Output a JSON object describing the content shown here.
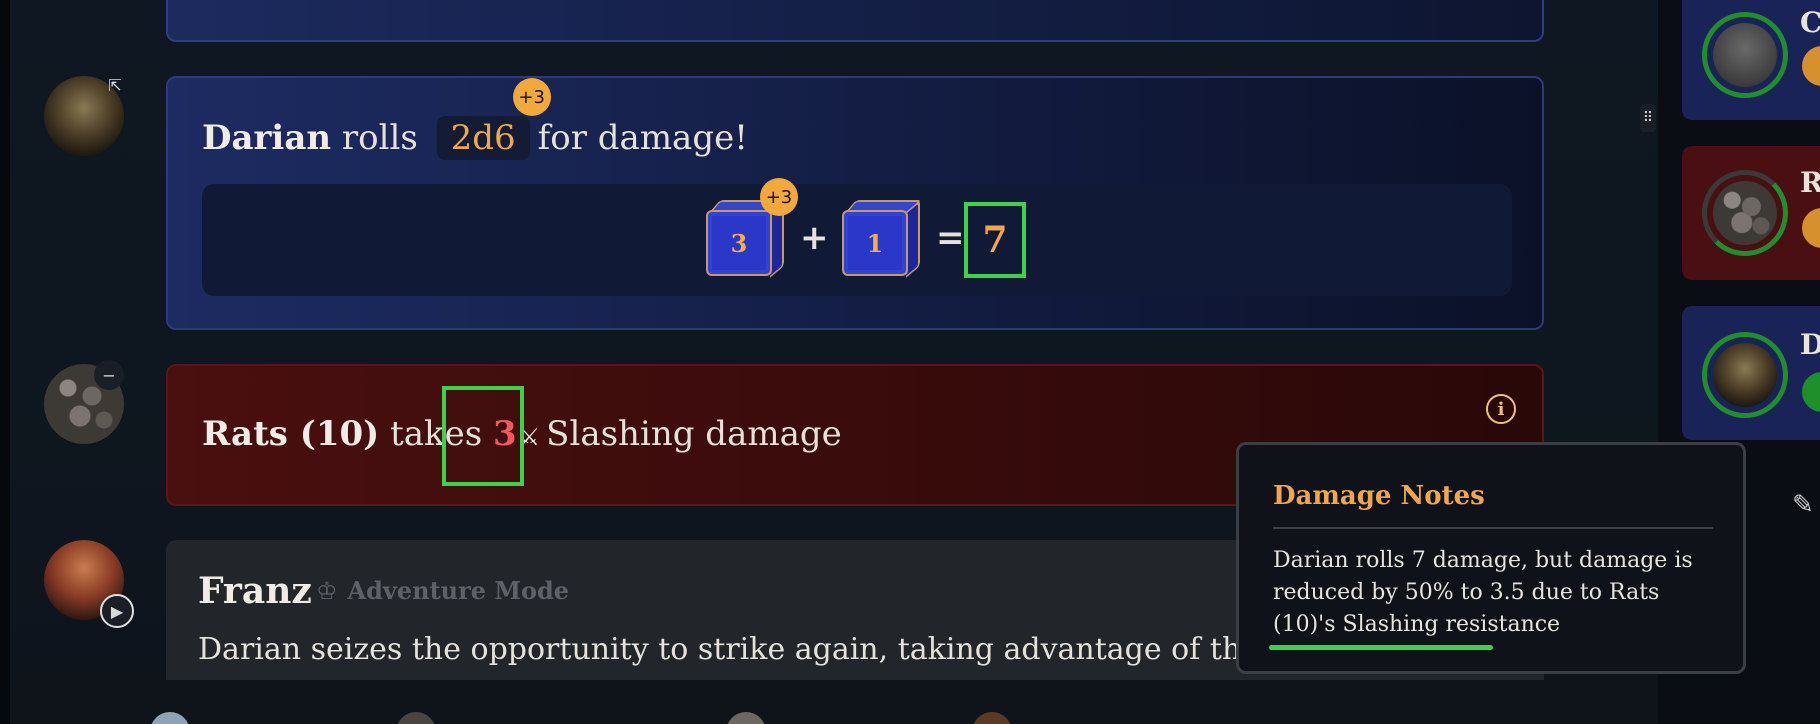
{
  "roll_message": {
    "actor": "Darian",
    "verb": "rolls",
    "dice": "2d6",
    "dice_modifier": "+3",
    "suffix": "for damage!",
    "dice_results": [
      "3",
      "1"
    ],
    "die_modifier": "+3",
    "plus": "+",
    "equals": "=",
    "total": "7"
  },
  "damage_message": {
    "target": "Rats (10)",
    "verb": "takes",
    "amount": "3",
    "damage_type": "Slashing damage",
    "icon": "slash-icon",
    "info_icon": "info-icon"
  },
  "narration": {
    "speaker": "Franz",
    "mode_label": "Adventure Mode",
    "text": "Darian seizes the opportunity to strike again, taking advantage of the s"
  },
  "tooltip": {
    "title": "Damage Notes",
    "body": "Darian rolls 7 damage, but damage is reduced by 50% to 3.5 due to Rats (10)'s Slashing resistance"
  },
  "initiative": [
    {
      "letter": "C"
    },
    {
      "letter": "R"
    },
    {
      "letter": "D"
    }
  ],
  "colors": {
    "accent_orange": "#f0a64a",
    "highlight_green": "#3ed14a",
    "damage_red": "#f05a5a",
    "roll_card_blue": "#1d2b62",
    "damage_card_red": "#4a0f0f"
  }
}
